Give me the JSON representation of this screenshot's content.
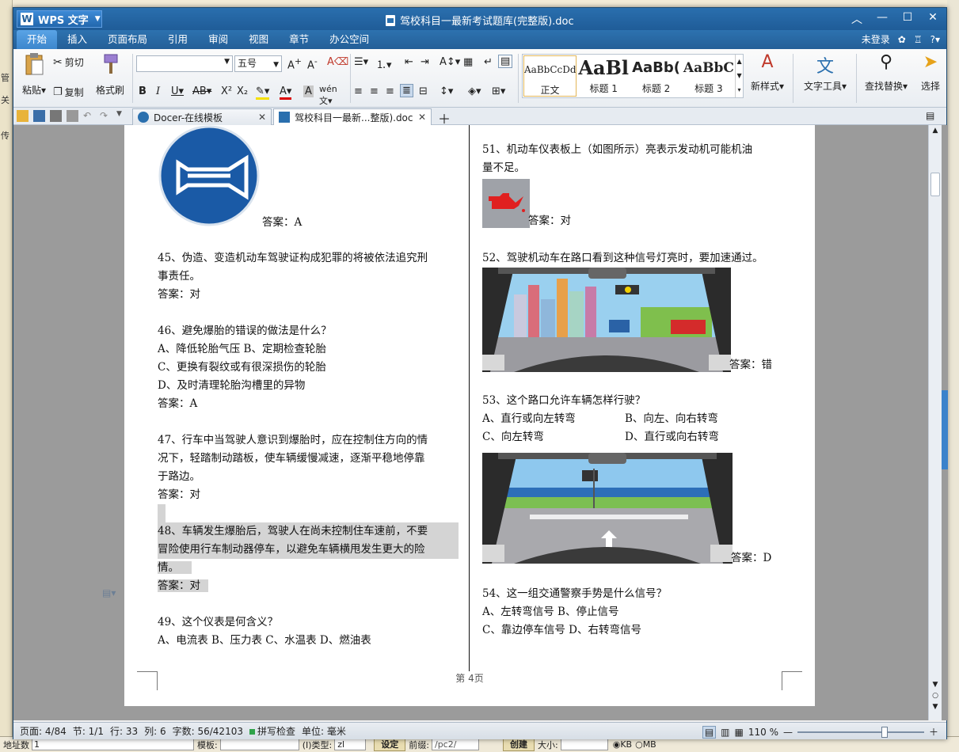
{
  "background": {
    "left_items": [
      "管",
      "关",
      "传"
    ],
    "bottom": {
      "address_label": "地址数",
      "address_value": "1",
      "template_label": "模板:",
      "type_label": "(I)类型:",
      "type_value": "zl",
      "set_button": "设定",
      "prefix_label": "前缀:",
      "prefix_value": "/pc2/",
      "create_button": "创建",
      "size_label": "大小:",
      "unit_kb": "KB",
      "unit_mb": "MB"
    }
  },
  "app": {
    "name": "WPS 文字",
    "window_title": "驾校科目一最新考试题库(完整版).doc"
  },
  "menu": {
    "tabs": [
      "开始",
      "插入",
      "页面布局",
      "引用",
      "审阅",
      "视图",
      "章节",
      "办公空间"
    ],
    "active": "开始",
    "login": "未登录"
  },
  "ribbon": {
    "paste": "粘贴",
    "cut": "剪切",
    "copy": "复制",
    "format_painter": "格式刷",
    "font_size": "五号",
    "styles": [
      {
        "preview": "AaBbCcDd",
        "label": "正文"
      },
      {
        "preview": "AaBl",
        "label": "标题 1"
      },
      {
        "preview": "AaBb(",
        "label": "标题 2"
      },
      {
        "preview": "AaBbC",
        "label": "标题 3"
      }
    ],
    "new_style": "新样式",
    "text_tools": "文字工具",
    "find_replace": "查找替换",
    "select": "选择"
  },
  "doc_tabs": [
    {
      "label": "Docer-在线模板"
    },
    {
      "label": "驾校科目一最新...整版).doc"
    }
  ],
  "document": {
    "left": {
      "q44_answer": "答案：A",
      "q45": [
        "45、伪造、变造机动车驾驶证构成犯罪的将被依法追究刑",
        "事责任。"
      ],
      "q45_answer": "答案：对",
      "q46": "46、避免爆胎的错误的做法是什么？",
      "q46_options": [
        "A、降低轮胎气压 B、定期检查轮胎",
        "C、更换有裂纹或有很深损伤的轮胎",
        "D、及时清理轮胎沟槽里的异物"
      ],
      "q46_answer": "答案：A",
      "q47": [
        "47、行车中当驾驶人意识到爆胎时，应在控制住方向的情",
        "况下，轻踏制动踏板，使车辆缓慢减速，逐渐平稳地停靠",
        "于路边。"
      ],
      "q47_answer": "答案：对",
      "q48": [
        "48、车辆发生爆胎后，驾驶人在尚未控制住车速前，不要",
        "冒险使用行车制动器停车，以避免车辆横甩发生更大的险",
        "情。"
      ],
      "q48_answer": "答案：对",
      "q49": "49、这个仪表是何含义？",
      "q49_options": "A、电流表 B、压力表 C、水温表 D、燃油表"
    },
    "right": {
      "q51": [
        "51、机动车仪表板上（如图所示）亮表示发动机可能机油",
        "量不足。"
      ],
      "q51_answer": "答案：对",
      "q52": "52、驾驶机动车在路口看到这种信号灯亮时，要加速通过。",
      "q52_answer": "答案：错",
      "q53": "53、这个路口允许车辆怎样行驶？",
      "q53_a": "A、直行或向左转弯",
      "q53_b": "B、向左、向右转弯",
      "q53_c": "C、向左转弯",
      "q53_d": "D、直行或向右转弯",
      "q53_answer": "答案：D",
      "q54": "54、这一组交通警察手势是什么信号？",
      "q54_options": [
        "A、左转弯信号 B、停止信号",
        "C、靠边停车信号 D、右转弯信号"
      ]
    },
    "page_footer": "第 4页"
  },
  "status": {
    "page": "页面: 4/84",
    "section": "节: 1/1",
    "line": "行: 33",
    "column": "列: 6",
    "word_count": "字数: 56/42103",
    "spell_check": "拼写检查",
    "unit": "单位: 毫米",
    "zoom": "110 %"
  },
  "colors": {
    "title_bar": "#1f5c98",
    "accent_blue": "#2a6fae",
    "highlight": "#d4d4d4"
  }
}
